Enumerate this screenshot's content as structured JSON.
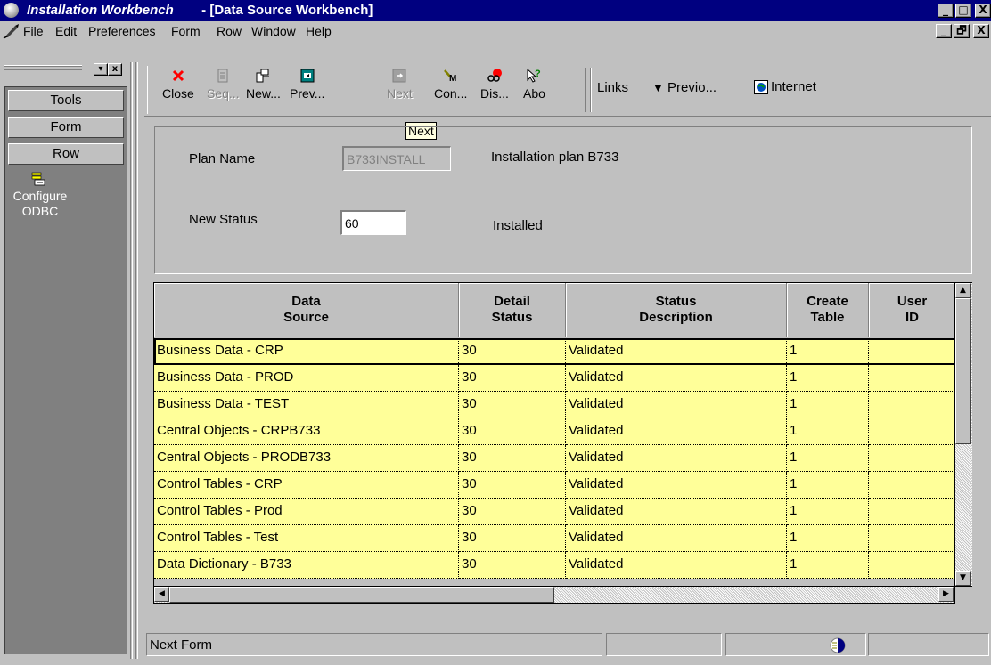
{
  "window": {
    "app_title": "Installation Workbench",
    "doc_title": " - [Data Source Workbench]",
    "caption_buttons": [
      "_",
      "□",
      "X"
    ],
    "mdi_buttons": [
      "_",
      "🗗",
      "X"
    ]
  },
  "menu": {
    "items": [
      {
        "label": "File"
      },
      {
        "label": "Edit"
      },
      {
        "label": "Preferences"
      },
      {
        "label": "Form"
      },
      {
        "label": "Row"
      },
      {
        "label": "Window"
      },
      {
        "label": "Help"
      }
    ]
  },
  "left_pane": {
    "buttons": [
      "Tools",
      "Form",
      "Row"
    ],
    "exit_item": {
      "label_line1": "Configure",
      "label_line2": "ODBC",
      "icon": "document-list-icon"
    }
  },
  "toolbar": {
    "buttons": [
      {
        "label": "Close",
        "icon": "close-icon",
        "enabled": true
      },
      {
        "label": "Seq...",
        "icon": "sequence-icon",
        "enabled": false
      },
      {
        "label": "New...",
        "icon": "new-icon",
        "enabled": true
      },
      {
        "label": "Prev...",
        "icon": "previous-icon",
        "enabled": true
      },
      {
        "label": "Next",
        "icon": "next-icon",
        "enabled": false
      },
      {
        "label": "Con...",
        "icon": "configure-icon",
        "enabled": true
      },
      {
        "label": "Dis...",
        "icon": "display-icon",
        "enabled": true
      },
      {
        "label": "Abo",
        "icon": "about-icon",
        "enabled": true
      }
    ],
    "links_label": "Links",
    "previous_label": "Previo...",
    "internet_label": "Internet"
  },
  "tooltip": {
    "text": "Next"
  },
  "form": {
    "plan_name_label": "Plan Name",
    "plan_name_value": "B733INSTALL",
    "plan_description": "Installation plan B733",
    "new_status_label": "New Status",
    "new_status_value": "60",
    "new_status_description": "Installed"
  },
  "grid": {
    "columns": [
      {
        "line1": "Data",
        "line2": "Source"
      },
      {
        "line1": "Detail",
        "line2": "Status"
      },
      {
        "line1": "Status",
        "line2": "Description"
      },
      {
        "line1": "Create",
        "line2": "Table"
      },
      {
        "line1": "User",
        "line2": "ID"
      }
    ],
    "rows": [
      {
        "data_source": "Business Data - CRP",
        "detail_status": "30",
        "status_description": "Validated",
        "create_table": "1",
        "user_id": ""
      },
      {
        "data_source": "Business Data - PROD",
        "detail_status": "30",
        "status_description": "Validated",
        "create_table": "1",
        "user_id": ""
      },
      {
        "data_source": "Business Data - TEST",
        "detail_status": "30",
        "status_description": "Validated",
        "create_table": "1",
        "user_id": ""
      },
      {
        "data_source": "Central Objects - CRPB733",
        "detail_status": "30",
        "status_description": "Validated",
        "create_table": "1",
        "user_id": ""
      },
      {
        "data_source": "Central Objects - PRODB733",
        "detail_status": "30",
        "status_description": "Validated",
        "create_table": "1",
        "user_id": ""
      },
      {
        "data_source": "Control Tables - CRP",
        "detail_status": "30",
        "status_description": "Validated",
        "create_table": "1",
        "user_id": ""
      },
      {
        "data_source": "Control Tables - Prod",
        "detail_status": "30",
        "status_description": "Validated",
        "create_table": "1",
        "user_id": ""
      },
      {
        "data_source": "Control Tables - Test",
        "detail_status": "30",
        "status_description": "Validated",
        "create_table": "1",
        "user_id": ""
      },
      {
        "data_source": "Data Dictionary - B733",
        "detail_status": "30",
        "status_description": "Validated",
        "create_table": "1",
        "user_id": ""
      }
    ],
    "row_color": "#ffff99"
  },
  "statusbar": {
    "text": "Next Form"
  },
  "colors": {
    "title_bar": "#000080",
    "face": "#c0c0c0",
    "row_highlight": "#ffff99",
    "close_icon": "#ff0000"
  }
}
